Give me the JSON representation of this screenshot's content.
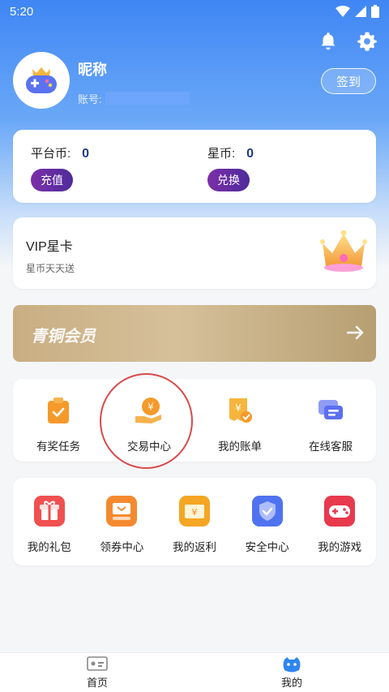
{
  "status": {
    "time": "5:20"
  },
  "profile": {
    "nickname": "昵称",
    "account_label": "账号:"
  },
  "signin_label": "签到",
  "coins": {
    "platform_label": "平台币:",
    "platform_value": "0",
    "star_label": "星币:",
    "star_value": "0",
    "recharge_label": "充值",
    "exchange_label": "兑换"
  },
  "vip": {
    "title": "VIP星卡",
    "subtitle": "星币天天送"
  },
  "bronze": {
    "title": "青铜会员"
  },
  "services": [
    {
      "label": "有奖任务",
      "icon": "clipboard-check-icon"
    },
    {
      "label": "交易中心",
      "icon": "coin-hand-icon"
    },
    {
      "label": "我的账单",
      "icon": "bill-icon"
    },
    {
      "label": "在线客服",
      "icon": "chat-icon"
    }
  ],
  "tools": [
    {
      "label": "我的礼包",
      "icon": "gift-icon",
      "color": "#f0504f"
    },
    {
      "label": "领券中心",
      "icon": "coupon-icon",
      "color": "#f48a2f"
    },
    {
      "label": "我的返利",
      "icon": "rebate-icon",
      "color": "#f5a623"
    },
    {
      "label": "安全中心",
      "icon": "shield-icon",
      "color": "#4f73f0"
    },
    {
      "label": "我的游戏",
      "icon": "gamepad-icon",
      "color": "#e8394d"
    }
  ],
  "nav": {
    "home": "首页",
    "mine": "我的"
  },
  "colors": {
    "accent": "#3f86f4",
    "pill": "#5b2ba0",
    "annotation": "#d94a4a"
  }
}
